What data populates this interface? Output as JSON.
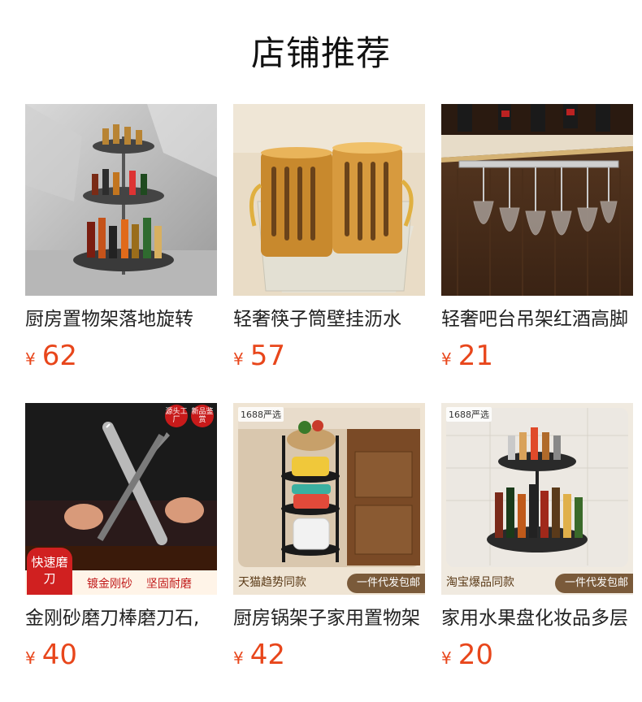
{
  "section": {
    "title": "店铺推荐"
  },
  "products": [
    {
      "name": "厨房置物架落地旋转",
      "currency": "¥",
      "price": "62"
    },
    {
      "name": "轻奢筷子筒壁挂沥水",
      "currency": "¥",
      "price": "57"
    },
    {
      "name": "轻奢吧台吊架红酒高脚",
      "currency": "¥",
      "price": "21"
    },
    {
      "name": "金刚砂磨刀棒磨刀石,",
      "currency": "¥",
      "price": "40",
      "image_text": {
        "badge1": "源头工厂",
        "badge2": "新品鉴赏",
        "corner": "快速磨刀",
        "banner_a": "镀金刚砂",
        "banner_b": "坚固耐磨"
      }
    },
    {
      "name": "厨房锅架子家用置物架",
      "currency": "¥",
      "price": "42",
      "image_text": {
        "top_tag": "1688严选",
        "bottom_left": "天猫趋势同款",
        "bottom_right": "一件代发包邮"
      }
    },
    {
      "name": "家用水果盘化妆品多层",
      "currency": "¥",
      "price": "20",
      "image_text": {
        "top_tag": "1688严选",
        "bottom_left": "淘宝爆品同款",
        "bottom_right": "一件代发包邮"
      }
    }
  ]
}
